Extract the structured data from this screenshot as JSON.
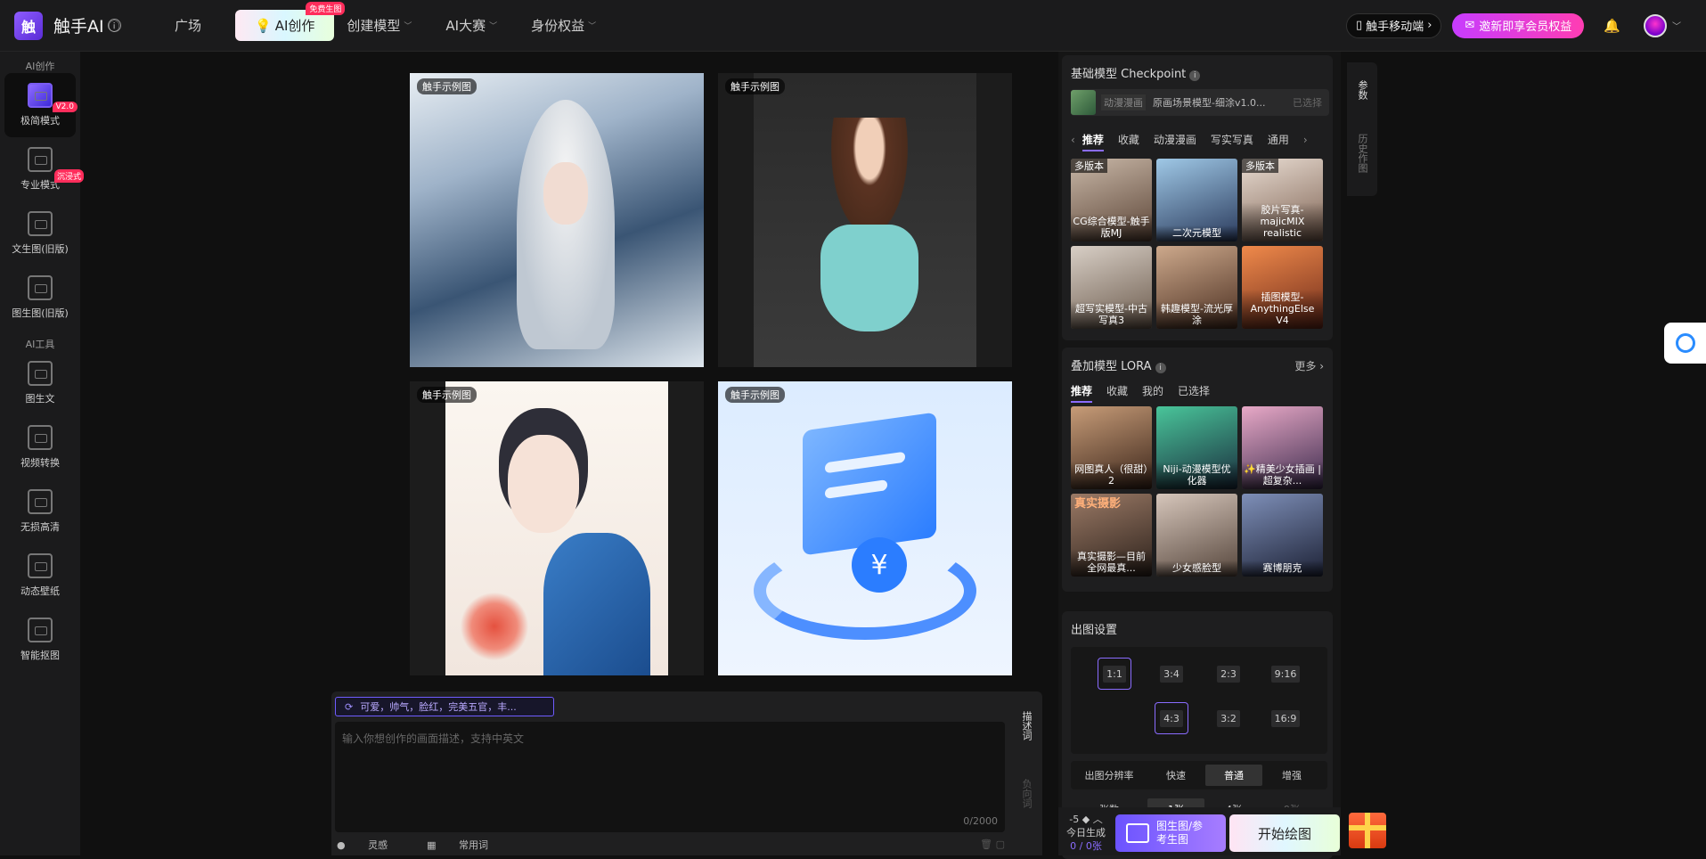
{
  "header": {
    "logo_char": "触",
    "app_name": "触手AI",
    "info_icon": "ⓘ",
    "nav": [
      {
        "label": "广场"
      },
      {
        "label": "AI创作",
        "badge": "免费生图"
      },
      {
        "label": "创建模型"
      },
      {
        "label": "AI大赛"
      },
      {
        "label": "身份权益"
      }
    ],
    "mobile_label": "触手移动端",
    "vip_label": "邀新即享会员权益"
  },
  "sidebar": {
    "section1": "AI创作",
    "section2": "AI工具",
    "items": [
      {
        "label": "极简模式",
        "badge": "V2.0"
      },
      {
        "label": "专业模式",
        "badge": "沉浸式"
      },
      {
        "label": "文生图(旧版)"
      },
      {
        "label": "图生图(旧版)"
      },
      {
        "label": "图生文"
      },
      {
        "label": "视频转换"
      },
      {
        "label": "无损高清"
      },
      {
        "label": "动态壁纸"
      },
      {
        "label": "智能抠图"
      }
    ]
  },
  "gallery": {
    "label": "触手示例图"
  },
  "prompt": {
    "chip": "可爱，帅气，脸红，完美五官，丰...",
    "placeholder": "输入你想创作的画面描述，支持中英文",
    "count": "0/2000",
    "tab_active": "描述词",
    "tab_inactive": "负向词",
    "foot1": "灵感",
    "foot2": "常用词"
  },
  "checkpoint": {
    "title": "基础模型 Checkpoint",
    "selected_tag": "动漫漫画",
    "selected_name": "原画场景模型-细涂v1.0...",
    "selected_state": "已选择",
    "tabs": [
      "推荐",
      "收藏",
      "动漫漫画",
      "写实写真",
      "通用"
    ],
    "models": [
      {
        "name": "CG综合模型-触手版MJ",
        "tag": "多版本"
      },
      {
        "name": "二次元模型",
        "tag": ""
      },
      {
        "name": "胶片写真-majicMIX realistic",
        "tag": "多版本"
      },
      {
        "name": "超写实模型-中古写真3",
        "tag": ""
      },
      {
        "name": "韩趣模型-流光厚涂",
        "tag": ""
      },
      {
        "name": "插图模型-AnythingElse V4",
        "tag": ""
      }
    ]
  },
  "lora": {
    "title": "叠加模型 LORA",
    "more": "更多",
    "tabs": [
      "推荐",
      "收藏",
      "我的",
      "已选择"
    ],
    "models": [
      {
        "name": "网图真人（很甜）2",
        "tag": ""
      },
      {
        "name": "Niji-动漫模型优化器",
        "tag": ""
      },
      {
        "name": "✨精美少女插画 | 超复杂...",
        "tag": ""
      },
      {
        "name": "真实摄影—目前全网最真...",
        "tag": "真实摄影"
      },
      {
        "name": "少女感脸型",
        "tag": ""
      },
      {
        "name": "赛博朋克",
        "tag": ""
      }
    ]
  },
  "output": {
    "title": "出图设置",
    "ratios_row1": [
      "1:1",
      "3:4",
      "2:3",
      "9:16"
    ],
    "ratios_row2": [
      "4:3",
      "3:2",
      "16:9"
    ],
    "res_label": "出图分辨率",
    "res_options": [
      "快速",
      "普通",
      "增强"
    ],
    "count_label": "张数",
    "count_options": [
      "1张",
      "4张",
      "9张"
    ]
  },
  "bottom": {
    "today_top": "-5",
    "today_label": "今日生成",
    "today_count": "0 / 0张",
    "img_ref": "图生图/参考生图",
    "start": "开始绘图"
  },
  "right_tabs": {
    "params": "参数",
    "history": "历史作图"
  },
  "colors": {
    "accent": "#8a6cff",
    "badge": "#ff2d5b",
    "vip": "#c73cff"
  }
}
